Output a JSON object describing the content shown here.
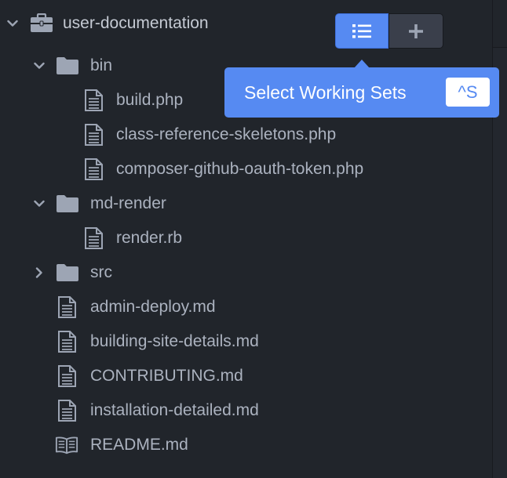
{
  "tree": {
    "root": {
      "label": "user-documentation",
      "expanded": true,
      "icon": "briefcase-icon"
    },
    "items": [
      {
        "label": "bin",
        "type": "folder",
        "expanded": true,
        "depth": 1
      },
      {
        "label": "build.php",
        "type": "file",
        "depth": 2
      },
      {
        "label": "class-reference-skeletons.php",
        "type": "file",
        "depth": 2
      },
      {
        "label": "composer-github-oauth-token.php",
        "type": "file",
        "depth": 2
      },
      {
        "label": "md-render",
        "type": "folder",
        "expanded": true,
        "depth": 1
      },
      {
        "label": "render.rb",
        "type": "file",
        "depth": 2
      },
      {
        "label": "src",
        "type": "folder",
        "expanded": false,
        "depth": 1
      },
      {
        "label": "admin-deploy.md",
        "type": "file",
        "depth": 1
      },
      {
        "label": "building-site-details.md",
        "type": "file",
        "depth": 1
      },
      {
        "label": "CONTRIBUTING.md",
        "type": "file",
        "depth": 1
      },
      {
        "label": "installation-detailed.md",
        "type": "file",
        "depth": 1
      },
      {
        "label": "README.md",
        "type": "book",
        "depth": 1
      }
    ]
  },
  "toolbar": {
    "list_icon": "list-icon",
    "add_icon": "plus-icon",
    "active": "list"
  },
  "tooltip": {
    "text": "Select Working Sets",
    "shortcut": "^S"
  },
  "colors": {
    "background": "#21252b",
    "text": "#abb2bf",
    "accent": "#568af2",
    "icon": "#9da5b4"
  }
}
